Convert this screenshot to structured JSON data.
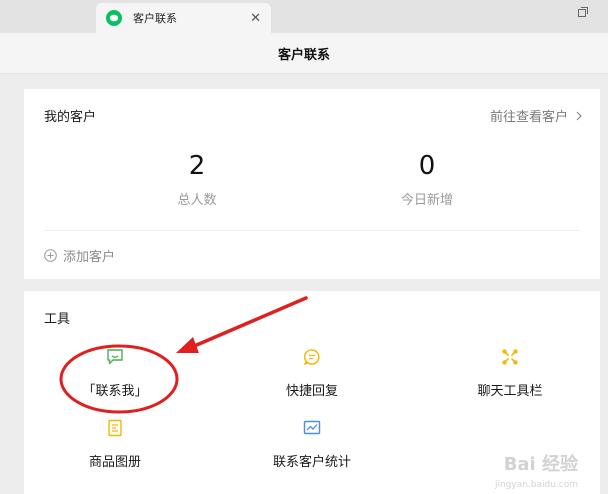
{
  "tab": {
    "title": "客户联系",
    "close_glyph": "✕"
  },
  "header": {
    "title": "客户联系"
  },
  "customers": {
    "title": "我的客户",
    "view_link": "前往查看客户",
    "total": {
      "value": "2",
      "label": "总人数"
    },
    "new_today": {
      "value": "0",
      "label": "今日新增"
    },
    "add_label": "添加客户"
  },
  "tools": {
    "title": "工具",
    "items": [
      {
        "label": "「联系我」",
        "icon": "chat-bubble-icon",
        "color": "#4caf50"
      },
      {
        "label": "快捷回复",
        "icon": "quick-reply-icon",
        "color": "#f5b800"
      },
      {
        "label": "聊天工具栏",
        "icon": "toolbar-icon",
        "color": "#f5b800"
      },
      {
        "label": "商品图册",
        "icon": "album-icon",
        "color": "#f5b800"
      },
      {
        "label": "联系客户统计",
        "icon": "stats-chart-icon",
        "color": "#4a90e2"
      }
    ]
  },
  "watermark": {
    "text": "Bai 经验",
    "sub": "jingyan.baidu.com"
  },
  "colors": {
    "annotation": "#e02020",
    "brand": "#07c160"
  }
}
